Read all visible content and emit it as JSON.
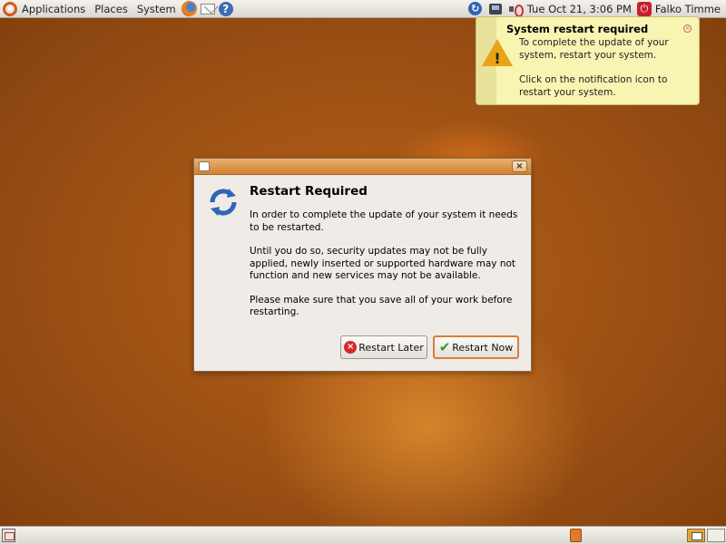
{
  "top_panel": {
    "menus": [
      "Applications",
      "Places",
      "System"
    ],
    "launchers": [
      "firefox-icon",
      "mail-icon",
      "help-icon"
    ],
    "clock": "Tue Oct 21,  3:06 PM",
    "user": "Falko Timme"
  },
  "notification": {
    "title": "System restart required",
    "body1": "To complete the update of your system, restart your system.",
    "body2": "Click on the notification icon to restart your system.",
    "icon": "warning-icon"
  },
  "dialog": {
    "heading": "Restart Required",
    "para1": "In order to complete the update of your system it needs to be restarted.",
    "para2": "Until you do so, security updates may not be fully applied, newly inserted or supported hardware may not function and new services may not be available.",
    "para3": "Please make sure that you save all of your work before restarting.",
    "button_later": "Restart Later",
    "button_now": "Restart Now",
    "icon": "refresh-icon"
  },
  "colors": {
    "accent": "#d0822f",
    "notification_bg": "#f8f4b2",
    "desktop": "#a8561a"
  }
}
